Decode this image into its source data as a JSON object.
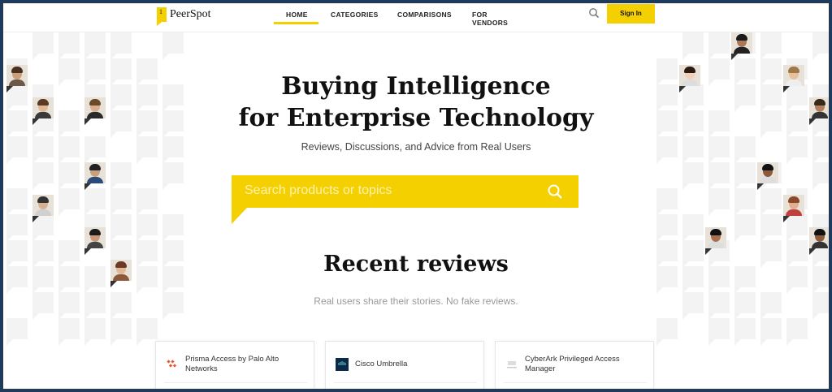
{
  "header": {
    "logo_text": "PeerSpot",
    "nav": [
      {
        "label": "HOME",
        "active": true
      },
      {
        "label": "CATEGORIES",
        "active": false
      },
      {
        "label": "COMPARISONS",
        "active": false
      },
      {
        "label": "FOR VENDORS",
        "active": false
      }
    ],
    "signin_label": "Sign In"
  },
  "hero": {
    "title_line1": "Buying Intelligence",
    "title_line2": "for Enterprise Technology",
    "subtitle": "Reviews, Discussions, and Advice from Real Users",
    "search_placeholder": "Search products or topics"
  },
  "recent": {
    "title": "Recent reviews",
    "subtitle": "Real users share their stories. No fake reviews.",
    "cards": [
      {
        "name": "Prisma Access by Palo Alto Networks"
      },
      {
        "name": "Cisco Umbrella"
      },
      {
        "name": "CyberArk Privileged Access Manager"
      }
    ]
  },
  "colors": {
    "accent": "#f5d000",
    "frame": "#1f3a5a"
  }
}
